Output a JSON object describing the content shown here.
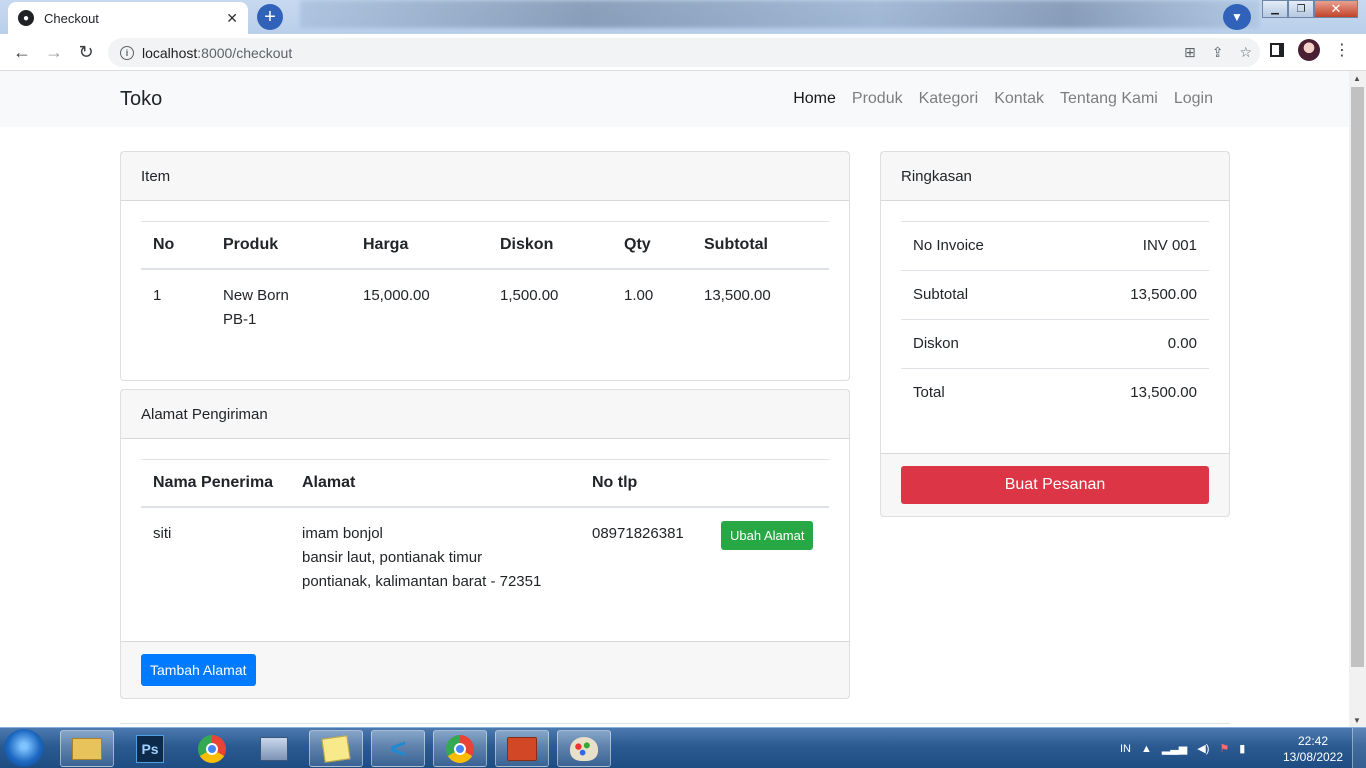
{
  "browser": {
    "tab_title": "Checkout",
    "url_host": "localhost",
    "url_port_path": ":8000/checkout"
  },
  "navbar": {
    "brand": "Toko",
    "links": [
      "Home",
      "Produk",
      "Kategori",
      "Kontak",
      "Tentang Kami",
      "Login"
    ]
  },
  "items_card": {
    "header": "Item",
    "columns": [
      "No",
      "Produk",
      "Harga",
      "Diskon",
      "Qty",
      "Subtotal"
    ],
    "rows": [
      {
        "no": "1",
        "produk_line1": "New Born",
        "produk_line2": "PB-1",
        "harga": "15,000.00",
        "diskon": "1,500.00",
        "qty": "1.00",
        "subtotal": "13,500.00"
      }
    ]
  },
  "address_card": {
    "header": "Alamat Pengiriman",
    "columns": [
      "Nama Penerima",
      "Alamat",
      "No tlp"
    ],
    "rows": [
      {
        "nama": "siti",
        "alamat_line1": "imam bonjol",
        "alamat_line2": "bansir laut, pontianak timur",
        "alamat_line3": "pontianak, kalimantan barat - 72351",
        "no_tlp": "08971826381",
        "edit_button": "Ubah Alamat"
      }
    ],
    "add_button": "Tambah Alamat"
  },
  "summary_card": {
    "header": "Ringkasan",
    "rows": [
      {
        "label": "No Invoice",
        "value": "INV 001"
      },
      {
        "label": "Subtotal",
        "value": "13,500.00"
      },
      {
        "label": "Diskon",
        "value": "0.00"
      },
      {
        "label": "Total",
        "value": "13,500.00"
      }
    ],
    "order_button": "Buat Pesanan"
  },
  "taskbar": {
    "language": "IN",
    "time": "22:42",
    "date": "13/08/2022",
    "ps_label": "Ps"
  },
  "colors": {
    "danger": "#dc3545",
    "success": "#28a745",
    "primary": "#007bff"
  }
}
